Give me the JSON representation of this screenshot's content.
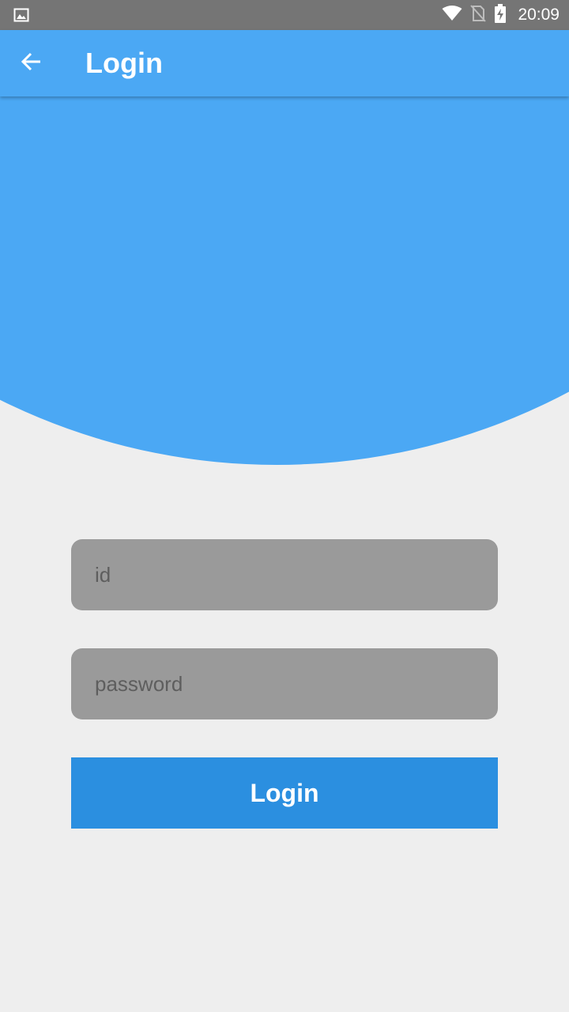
{
  "status_bar": {
    "time": "20:09",
    "icons": [
      "image-notification-icon",
      "wifi-icon",
      "no-sim-icon",
      "battery-charging-icon"
    ]
  },
  "app_bar": {
    "title": "Login",
    "back_icon": "arrow-back-icon"
  },
  "form": {
    "id_placeholder": "id",
    "password_placeholder": "password",
    "login_button_label": "Login"
  },
  "colors": {
    "primary": "#4BA8F4",
    "button": "#2B8FE0",
    "field_background": "#9A9A9A",
    "page_background": "#EEEEEE",
    "status_bar": "#757575"
  }
}
